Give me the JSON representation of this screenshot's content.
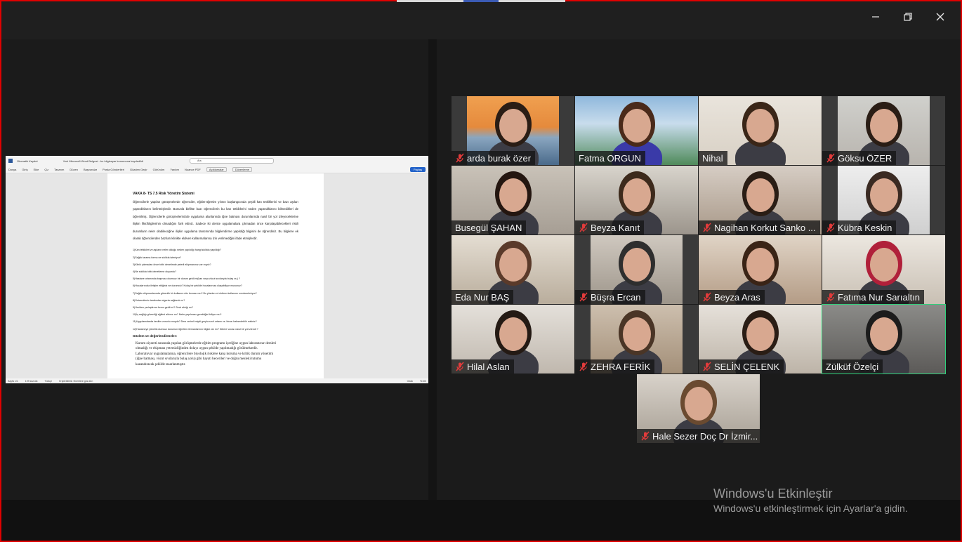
{
  "window": {
    "controls": {
      "minimize": "–",
      "restore": "❐",
      "close": "✕"
    }
  },
  "shared_screen": {
    "titlebar": {
      "autosave": "Otomatik Kaydet",
      "doc_name": "Yeni Microsoft Word Belgesi - bu bilgisayar konumuna kaydedildi",
      "search": "Ara"
    },
    "ribbon": {
      "tabs": [
        "Dosya",
        "Giriş",
        "Ekle",
        "Çiz",
        "Tasarım",
        "Düzen",
        "Başvurular",
        "Posta Gönderileri",
        "Gözden Geçir",
        "Görünüm",
        "Yardım",
        "Nuance PDF"
      ],
      "comments": "Açıklamalar",
      "editing": "Düzenleme",
      "share": "Paylaş"
    },
    "document": {
      "title": "VAKA 8- TS 7.5 Risk Yönetim Sistemi",
      "paragraph": "Öğrencilerle yapılan görüşmelerde öğrenciler, eğitim-öğretim yılının başlangıcında çeşitli kan tetkiklerini ve bazı aşıları yaptırdıklarını belirtmişlerdir. Bununla birlikte bazı öğrencilerin bu kan tetkiklerini neden yaptırdıklarını bilmedikleri de öğrenilmiş. Öğrencilerle görüşmelerinizde uygulama alanlarında iğne batması durumlarında nasıl bir yol izleyeceklerine ilişkin fikir/bilgilerinin olmadığını fark ettiniz. Sadece iki derste uygulamalara çıkmadan önce karşılaşabilecekleri riskli durumların neler olabileceğine ilişkin uygulama tanıtımında bilgilendirme yapıldığı bilgisini de öğrendiniz. Bu bilgilere ek olarak öğrencilerden bazıları klinikte eldiven kullanmalarına izin verilmediğini ifade etmişlerdir.",
      "questions": [
        "1)Kan tetkikleri ve aşıların neler olduğu neden yapıldığı hangi sıklıkla yapıldığı?",
        "2)Sağlık tarama formu ne sıklıkla isteniyor?",
        "3)Klinik çıkmadan önce tıbbi denetimde yeterli ekipmanınız var mıydı?",
        "4)Ne sıklıkla tıbbi denetleme oluyordu?",
        "5)Hastane ortamında başınıza olumsuz bir durum geldi mi(kan veya vücut sıvılarıyla bulaş vs.) ?",
        "6)Hocalarınızla iletişim ettiğiniz ne durumdu? Kolay bir şekilde hocalarınıza ulaşabiliyor musunuz?",
        "7)Sağlık ekipmanlarında güvenlik bir kullanım söz konusu mu? Bu yüzden mi eldiven kullanımı sınırlandırılıyor?",
        "8)Üniversiteniz tarafından sigorta sağlandı mı?",
        "9)Yeniden yerleştirme formu geldi mi? Sevk aktığı mı?",
        "10)İş sağlığı güvenliği eğitimi aldınız mı? Neler yapılması gerektiğini biliyor mu?",
        "11)Uygulamalarda kesilim zorunlu muydu? Ders verimli miydi grupla sınıf ortamı vs. birazı bahsedebilir misiniz?",
        "12)Hastaneye yönelik olumsuz durumun öğretim elemanlarının bilgisi var mı? Nelere vurası nasıl bir yol izlendi ?"
      ],
      "heading": "Gözlem ve değerlendirmeler:",
      "serif_lines": [
        "Kurum ziyareti sırasında yapılan görüşmelerde eğitim programı içeriğine uygun laboratuvar dersleri",
        "olmadığı ve ekipman yetersizliğinden dolayı uygun şekilde yapılmadığı görülmektedir.",
        "Laboratuvar uygulamalarına, öğrencilere biyolojik risklere karşı koruma ve kritik durum yönetimi",
        "(iğne batması, vücut sıvılarıyla bulaş yolu) gibi hayati becerileri ve doğru mesleki tutumu",
        "kazandıracak şekilde tasarlanmıştır."
      ]
    },
    "statusbar": {
      "page": "Sayfa 1/1",
      "words": "199 sözcük",
      "language": "Türkçe",
      "accessibility": "Erişilebilirlik: Önerilere göz atın",
      "focus": "Odak",
      "zoom": "%100"
    }
  },
  "participants": [
    {
      "name": "arda burak özer",
      "muted": true
    },
    {
      "name": "Fatma ORGUN",
      "muted": false
    },
    {
      "name": "Nihal",
      "muted": false
    },
    {
      "name": "Göksu ÖZER",
      "muted": true
    },
    {
      "name": "Busegül ŞAHAN",
      "muted": false
    },
    {
      "name": "Beyza Kanıt",
      "muted": true
    },
    {
      "name": "Nagihan Korkut Sanko ...",
      "muted": true
    },
    {
      "name": "Kübra Keskin",
      "muted": true
    },
    {
      "name": "Eda Nur BAŞ",
      "muted": false
    },
    {
      "name": "Büşra Ercan",
      "muted": true
    },
    {
      "name": "Beyza Aras",
      "muted": true
    },
    {
      "name": "Fatıma Nur Sarıaltın",
      "muted": true
    },
    {
      "name": "Hilal Aslan",
      "muted": true
    },
    {
      "name": "ZEHRA FERİK",
      "muted": true
    },
    {
      "name": "SELİN ÇELENK",
      "muted": true
    },
    {
      "name": "Zülküf Özelçi",
      "muted": false,
      "active_speaker": true
    },
    {
      "name": "Hale Sezer Doç Dr İzmir...",
      "muted": true
    }
  ],
  "watermark": {
    "title": "Windows'u Etkinleştir",
    "subtitle": "Windows'u etkinleştirmek için Ayarlar'a gidin."
  },
  "colors": {
    "frame": "#e00000",
    "active_speaker": "#2fd17b",
    "muted_icon": "#e23b3b",
    "background": "#1b1b1b"
  }
}
